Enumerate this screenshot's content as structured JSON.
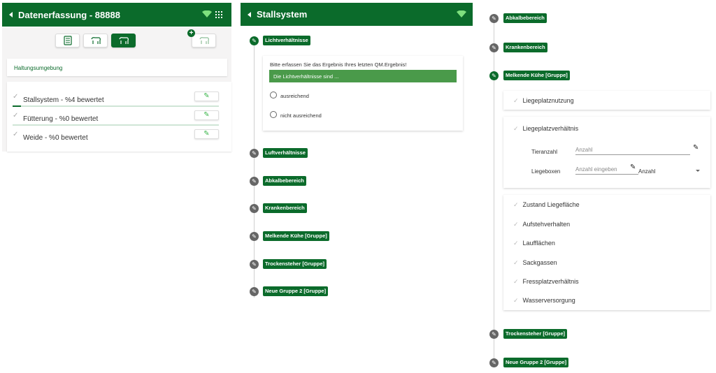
{
  "panel_datenerfassung": {
    "title": "Datenerfassung - 88888",
    "haltung_label": "Haltungsumgebung",
    "items": [
      {
        "label": "Stallsystem - %4 bewertet",
        "progress": 0.04
      },
      {
        "label": "Fütterung - %0 bewertet",
        "progress": 0
      },
      {
        "label": "Weide - %0 bewertet",
        "progress": 0
      }
    ]
  },
  "panel_stallsystem": {
    "title": "Stallsystem",
    "active_step": "Lichtverhältnisse",
    "question": {
      "prompt": "Bitte erfassen Sie das Ergebnis Ihres letzten QM.Ergebnis!",
      "header": "Die Lichtverhältnisse sind ...",
      "options": [
        "ausreichend",
        "nicht ausreichend"
      ]
    },
    "steps": [
      "Luftverhältnisse",
      "Abkalbebereich",
      "Krankenbereich",
      "Melkende Kühe [Gruppe]",
      "Trockensteher [Gruppe]",
      "Neue Gruppe 2 [Gruppe]"
    ]
  },
  "panel_gruppe": {
    "steps_top": [
      "Abkalbebereich",
      "Krankenbereich"
    ],
    "active_group": "Melkende Kühe [Gruppe]",
    "liegeplatznutzung": "Liegeplatznutzung",
    "liegeplatzverhaeltnis": {
      "title": "Liegeplatzverhältnis",
      "tieranzahl_label": "Tieranzahl",
      "tieranzahl_placeholder": "Anzahl",
      "liegeboxen_label": "Liegeboxen",
      "liegeboxen_placeholder": "Anzahl eingeben",
      "unit_select": "Anzahl"
    },
    "criteria": [
      "Zustand Liegefläche",
      "Aufstehverhalten",
      "Laufflächen",
      "Sackgassen",
      "Fressplatzverhältnis",
      "Wasserversorgung"
    ],
    "steps_bottom": [
      "Trockensteher [Gruppe]",
      "Neue Gruppe 2 [Gruppe]"
    ]
  },
  "icons": {
    "check": "✓",
    "pencil": "✎",
    "plus": "+"
  },
  "colors": {
    "brand_green": "#0b6b2b",
    "question_green": "#4a9a4a",
    "check_green": "#3bb54a"
  }
}
